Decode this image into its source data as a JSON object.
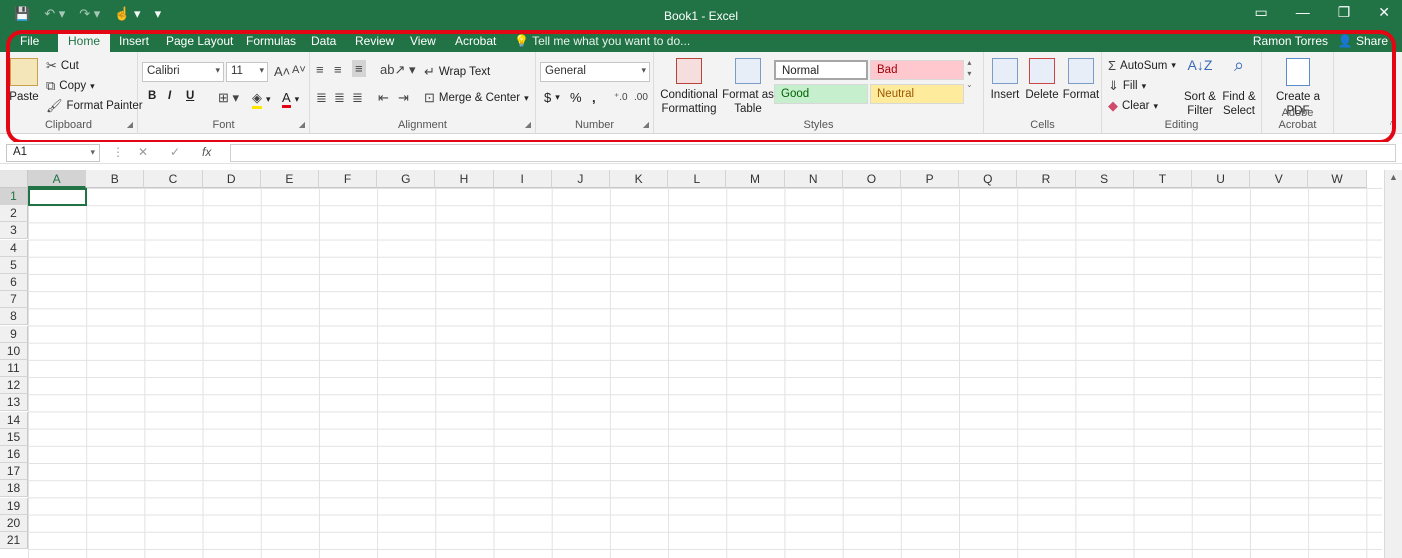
{
  "titlebar": {
    "title": "Book1 - Excel"
  },
  "tabs": [
    "File",
    "Home",
    "Insert",
    "Page Layout",
    "Formulas",
    "Data",
    "Review",
    "View",
    "Acrobat"
  ],
  "tell_me": "Tell me what you want to do...",
  "user": "Ramon Torres",
  "share": "Share",
  "ribbon": {
    "clipboard": {
      "paste": "Paste",
      "cut": "Cut",
      "copy": "Copy",
      "format_painter": "Format Painter",
      "label": "Clipboard"
    },
    "font": {
      "name": "Calibri",
      "size": "11",
      "bold": "B",
      "italic": "I",
      "underline": "U",
      "label": "Font"
    },
    "alignment": {
      "wrap_text": "Wrap Text",
      "merge_center": "Merge & Center",
      "label": "Alignment"
    },
    "number": {
      "format": "General",
      "currency": "$",
      "percent": "%",
      "comma": ",",
      "label": "Number"
    },
    "styles": {
      "conditional": "Conditional Formatting",
      "format_table": "Format as Table",
      "normal": "Normal",
      "bad": "Bad",
      "good": "Good",
      "neutral": "Neutral",
      "label": "Styles"
    },
    "cells": {
      "insert": "Insert",
      "delete": "Delete",
      "format": "Format",
      "label": "Cells"
    },
    "editing": {
      "autosum": "AutoSum",
      "fill": "Fill",
      "clear": "Clear",
      "sort_filter": "Sort & Filter",
      "find_select": "Find & Select",
      "label": "Editing"
    },
    "acrobat": {
      "create_pdf": "Create a PDF",
      "label": "Adobe Acrobat"
    }
  },
  "formula_bar": {
    "name_box": "A1",
    "fx": "fx"
  },
  "columns": [
    "A",
    "B",
    "C",
    "D",
    "E",
    "F",
    "G",
    "H",
    "I",
    "J",
    "K",
    "L",
    "M",
    "N",
    "O",
    "P",
    "Q",
    "R",
    "S",
    "T",
    "U",
    "V",
    "W"
  ],
  "rows": [
    "1",
    "2",
    "3",
    "4",
    "5",
    "6",
    "7",
    "8",
    "9",
    "10",
    "11",
    "12",
    "13",
    "14",
    "15",
    "16",
    "17",
    "18",
    "19",
    "20",
    "21"
  ],
  "colors": {
    "accent": "#217346",
    "highlight": "#e30613"
  }
}
